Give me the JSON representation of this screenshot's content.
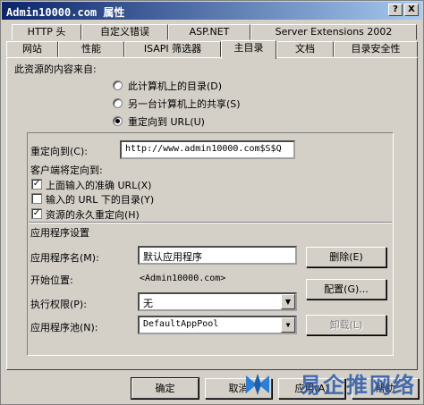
{
  "window": {
    "title": "Admin10000.com 属性",
    "help_button": "?",
    "close_button": "X"
  },
  "tabs_row1": [
    "HTTP 头",
    "自定义错误",
    "ASP.NET",
    "Server Extensions 2002"
  ],
  "tabs_row2": [
    "网站",
    "性能",
    "ISAPI 筛选器",
    "主目录",
    "文档",
    "目录安全性"
  ],
  "active_tab": "主目录",
  "content_source": {
    "heading": "此资源的内容来自:",
    "options": [
      {
        "label": "此计算机上的目录(D)",
        "checked": false
      },
      {
        "label": "另一台计算机上的共享(S)",
        "checked": false
      },
      {
        "label": "重定向到 URL(U)",
        "checked": true
      }
    ]
  },
  "redirect": {
    "label": "重定向到(C):",
    "value": "http://www.admin10000.com$S$Q",
    "client_heading": "客户端将定向到:",
    "checkboxes": [
      {
        "label": "上面输入的准确 URL(X)",
        "checked": true
      },
      {
        "label": "输入的 URL 下的目录(Y)",
        "checked": false
      },
      {
        "label": "资源的永久重定向(H)",
        "checked": true
      }
    ]
  },
  "app_settings": {
    "heading": "应用程序设置",
    "app_name_label": "应用程序名(M):",
    "app_name_value": "默认应用程序",
    "remove_button": "删除(E)",
    "start_point_label": "开始位置:",
    "start_point_value": "<Admin10000.com>",
    "config_button": "配置(G)...",
    "exec_perm_label": "执行权限(P):",
    "exec_perm_value": "无",
    "app_pool_label": "应用程序池(N):",
    "app_pool_value": "DefaultAppPool",
    "unload_button": "卸载(L)"
  },
  "footer": {
    "ok": "确定",
    "cancel": "取消",
    "apply": "应用(A)",
    "help": "帮助"
  },
  "watermark": {
    "text": "易企推网络"
  }
}
